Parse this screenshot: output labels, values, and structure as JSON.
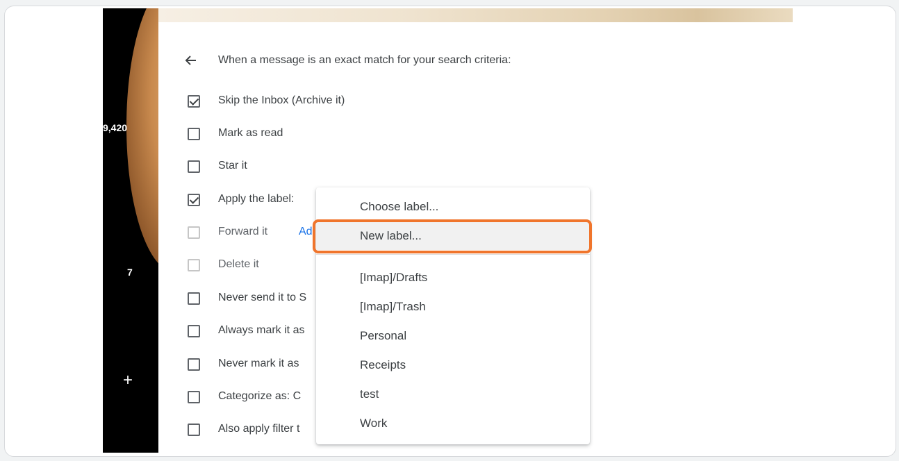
{
  "sidebar": {
    "mail_count": "9,420",
    "badge_count": "7",
    "compose_glyph": "+"
  },
  "filter": {
    "back_icon": "arrow-left-icon",
    "title": "When a message is an exact match for your search criteria:",
    "options": [
      {
        "label": "Skip the Inbox (Archive it)",
        "checked": true,
        "dim": false
      },
      {
        "label": "Mark as read",
        "checked": false,
        "dim": false
      },
      {
        "label": "Star it",
        "checked": false,
        "dim": false
      },
      {
        "label": "Apply the label:",
        "checked": true,
        "dim": false
      },
      {
        "label": "Forward it",
        "checked": false,
        "dim": true,
        "link": "Ad"
      },
      {
        "label": "Delete it",
        "checked": false,
        "dim": true
      },
      {
        "label": "Never send it to S",
        "checked": false,
        "dim": false
      },
      {
        "label": "Always mark it as",
        "checked": false,
        "dim": false
      },
      {
        "label": "Never mark it as",
        "checked": false,
        "dim": false
      },
      {
        "label": "Categorize as: C",
        "checked": false,
        "dim": false
      },
      {
        "label": "Also apply filter t",
        "checked": false,
        "dim": false
      }
    ]
  },
  "label_dropdown": {
    "items": [
      {
        "label": "Choose label..."
      },
      {
        "label": "New label...",
        "highlighted": true
      },
      {
        "label": "[Imap]/Drafts"
      },
      {
        "label": "[Imap]/Trash"
      },
      {
        "label": "Personal"
      },
      {
        "label": "Receipts"
      },
      {
        "label": "test"
      },
      {
        "label": "Work"
      }
    ],
    "highlight_color": "#f0752c"
  }
}
